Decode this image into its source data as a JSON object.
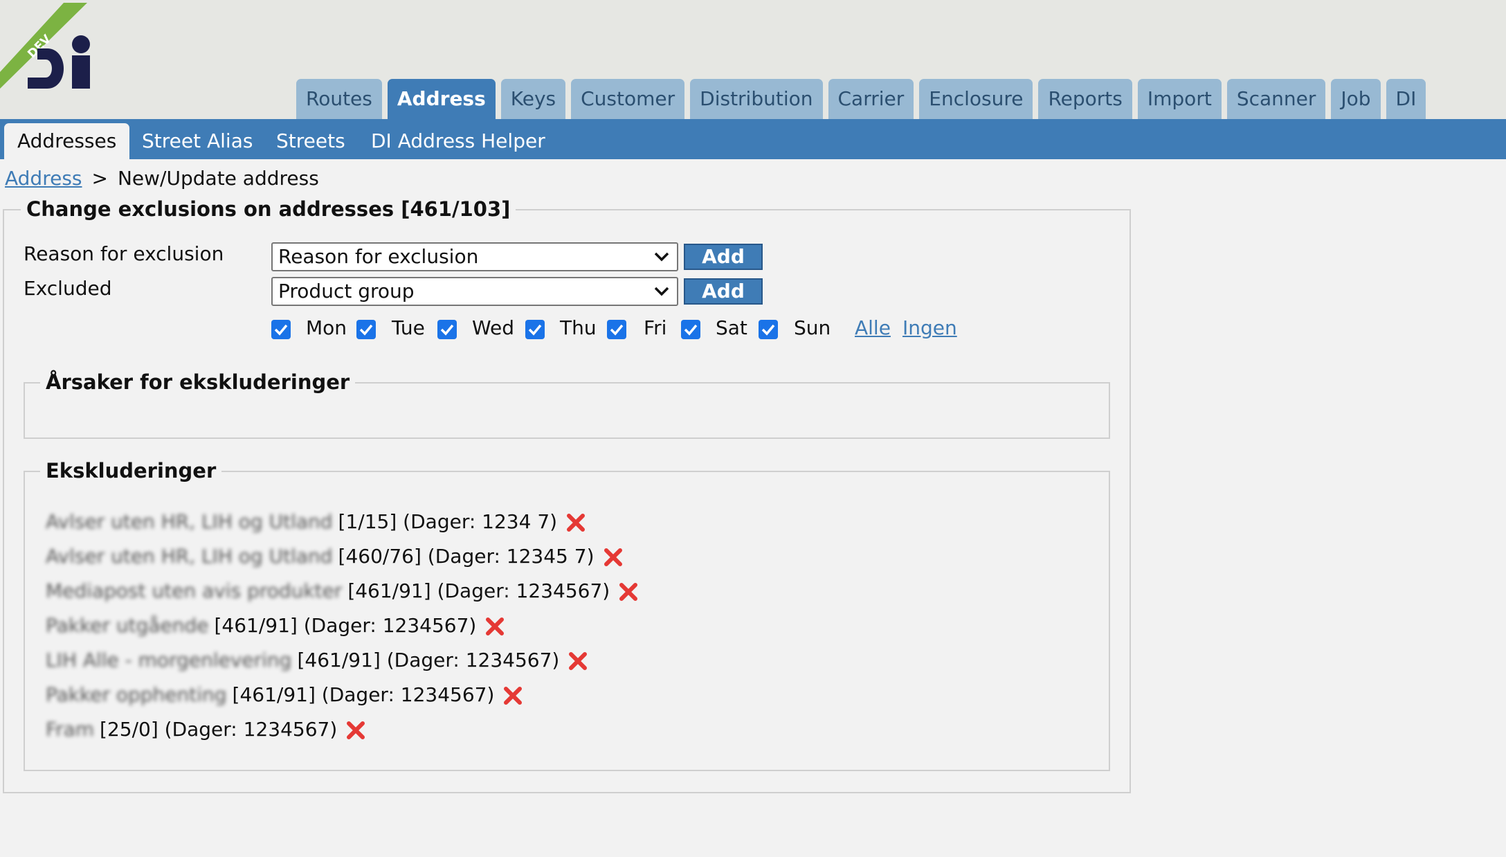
{
  "logo": {
    "ribbon": "DEV"
  },
  "main_tabs": [
    {
      "label": "Routes"
    },
    {
      "label": "Address",
      "active": true
    },
    {
      "label": "Keys"
    },
    {
      "label": "Customer"
    },
    {
      "label": "Distribution"
    },
    {
      "label": "Carrier"
    },
    {
      "label": "Enclosure"
    },
    {
      "label": "Reports"
    },
    {
      "label": "Import"
    },
    {
      "label": "Scanner"
    },
    {
      "label": "Job"
    },
    {
      "label": "DI"
    }
  ],
  "sub_tabs": [
    {
      "label": "Addresses",
      "active": true
    },
    {
      "label": "Street Alias"
    },
    {
      "label": "Streets"
    },
    {
      "label": "DI Address Helper"
    }
  ],
  "breadcrumb": {
    "link": "Address",
    "separator": ">",
    "current": "New/Update address"
  },
  "form": {
    "legend": "Change exclusions on addresses [461/103]",
    "reason_label": "Reason for exclusion",
    "reason_select": "Reason for exclusion",
    "excluded_label": "Excluded",
    "excluded_select": "Product group",
    "add_label": "Add",
    "days": [
      {
        "label": "Mon",
        "checked": true
      },
      {
        "label": "Tue",
        "checked": true
      },
      {
        "label": "Wed",
        "checked": true
      },
      {
        "label": "Thu",
        "checked": true
      },
      {
        "label": "Fri",
        "checked": true
      },
      {
        "label": "Sat",
        "checked": true
      },
      {
        "label": "Sun",
        "checked": true
      }
    ],
    "all_link": "Alle",
    "none_link": "Ingen"
  },
  "reasons_section": {
    "legend": "Årsaker for ekskluderinger"
  },
  "exclusions_section": {
    "legend": "Ekskluderinger",
    "items": [
      {
        "name": "Avlser uten HR, LIH og Utland",
        "detail": "[1/15] (Dager: 1234 7)"
      },
      {
        "name": "Avlser uten HR, LIH og Utland",
        "detail": "[460/76] (Dager: 12345 7)"
      },
      {
        "name": "Mediapost uten avis produkter",
        "detail": "[461/91] (Dager: 1234567)"
      },
      {
        "name": "Pakker utgående",
        "detail": "[461/91] (Dager: 1234567)"
      },
      {
        "name": "LIH Alle - morgenlevering",
        "detail": "[461/91] (Dager: 1234567)"
      },
      {
        "name": "Pakker opphenting",
        "detail": "[461/91] (Dager: 1234567)"
      },
      {
        "name": "Fram",
        "detail": "[25/0] (Dager: 1234567)"
      }
    ]
  },
  "colors": {
    "nav_blue": "#3f7cb6",
    "tab_light": "#98b9d3",
    "logo_green": "#7cb342",
    "logo_navy": "#1c1f4a",
    "delete_red": "#e53935"
  }
}
